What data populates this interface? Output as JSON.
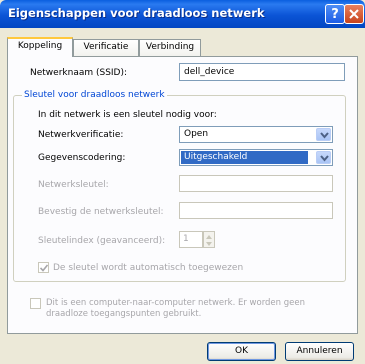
{
  "window": {
    "title": "Eigenschappen voor draadloos netwerk"
  },
  "titlebar_buttons": {
    "help": "?",
    "close": "X"
  },
  "tabs": [
    {
      "label": "Koppeling",
      "active": true
    },
    {
      "label": "Verificatie",
      "active": false
    },
    {
      "label": "Verbinding",
      "active": false
    }
  ],
  "ssid": {
    "label": "Netwerknaam (SSID):",
    "value": "dell_device"
  },
  "key_group": {
    "title": "Sleutel voor draadloos netwerk",
    "intro": "In dit netwerk is een sleutel nodig voor:",
    "auth_label": "Netwerkverificatie:",
    "auth_value": "Open",
    "enc_label": "Gegevenscodering:",
    "enc_value": "Uitgeschakeld",
    "netkey_label": "Netwerksleutel:",
    "netkey_value": "",
    "confirm_label": "Bevestig de netwerksleutel:",
    "confirm_value": "",
    "index_label": "Sleutelindex (geavanceerd):",
    "index_value": "1",
    "auto_key_label": "De sleutel wordt automatisch toegewezen",
    "auto_key_checked": true
  },
  "adhoc": {
    "line1": "Dit is een computer-naar-computer netwerk. Er worden geen",
    "line2": "draadloze toegangspunten gebruikt.",
    "checked": false
  },
  "buttons": {
    "ok": "OK",
    "cancel": "Annuleren"
  },
  "colors": {
    "accent": "#0046d5",
    "selection": "#316ac5",
    "titlebar": "#0b54d6"
  }
}
